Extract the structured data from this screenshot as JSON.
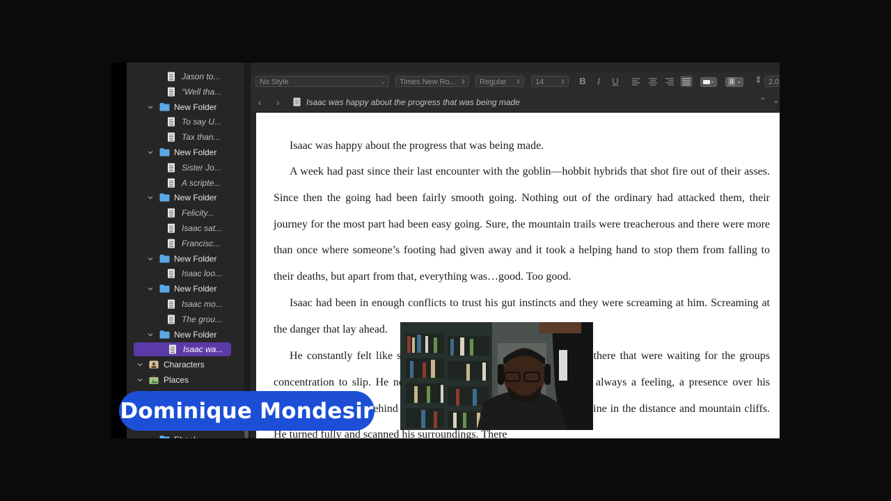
{
  "binder": {
    "items": [
      {
        "type": "doc",
        "label": "Jason to..."
      },
      {
        "type": "doc",
        "label": "“Well tha..."
      },
      {
        "type": "folder",
        "label": "New Folder"
      },
      {
        "type": "doc",
        "label": "To say U..."
      },
      {
        "type": "doc",
        "label": "Tax than..."
      },
      {
        "type": "folder",
        "label": "New Folder"
      },
      {
        "type": "doc",
        "label": "Sister Jo..."
      },
      {
        "type": "doc",
        "label": "A scripte..."
      },
      {
        "type": "folder",
        "label": "New Folder"
      },
      {
        "type": "doc",
        "label": "Felicity..."
      },
      {
        "type": "doc",
        "label": "Isaac sat..."
      },
      {
        "type": "doc",
        "label": "Francisc..."
      },
      {
        "type": "folder",
        "label": "New Folder"
      },
      {
        "type": "doc",
        "label": "Isaac loo..."
      },
      {
        "type": "folder",
        "label": "New Folder"
      },
      {
        "type": "doc",
        "label": "Isaac mo..."
      },
      {
        "type": "doc",
        "label": "The grou..."
      },
      {
        "type": "folder",
        "label": "New Folder"
      },
      {
        "type": "doc",
        "label": "Isaac wa...",
        "selected": true
      },
      {
        "type": "section",
        "label": "Characters",
        "icon": "characters-icon"
      },
      {
        "type": "section",
        "label": "Places",
        "icon": "places-icon"
      }
    ],
    "hidden_item_label": "Ebook"
  },
  "formatbar": {
    "style": "No Style",
    "font_family": "Times New Ro...",
    "font_weight": "Regular",
    "font_size": "14",
    "bold": "B",
    "italic": "I",
    "underline": "U",
    "highlight_label": "a",
    "line_spacing": "2.0"
  },
  "header": {
    "doc_title": "Isaac was happy about the progress that was being made"
  },
  "editor": {
    "paragraphs": [
      "Isaac was happy about the progress that was being made.",
      "A week had past since their last encounter with the goblin—hobbit hybrids that shot fire out of their asses. Since then the going had been fairly smooth going. Nothing out of the ordinary had attacked them, their journey for the most part had been easy going. Sure, the mountain trails were treacherous and there were more than once where  someone’s footing had given away and it took a helping hand to stop them from falling to their deaths, but apart from that, everything was…good. Too good.",
      "Isaac had been in enough conflicts to trust his gut instincts and they were screaming at him. Screaming at the danger that lay ahead.",
      "He constantly felt like something was watching them, things out there that were waiting for the groups concentration to slip. He never actually saw anything but there was always a feeling, a presence over his shoulder. He looked behind him, but he saw nothing but a dense tree line in the distance and mountain cliffs. He turned fully and scanned his surroundings. There"
    ]
  },
  "overlay": {
    "presenter_name": "Dominique Mondesir"
  },
  "colors": {
    "selection": "#5b3aa8",
    "folder": "#5aa8e6",
    "name_badge": "#1c4fd6"
  }
}
